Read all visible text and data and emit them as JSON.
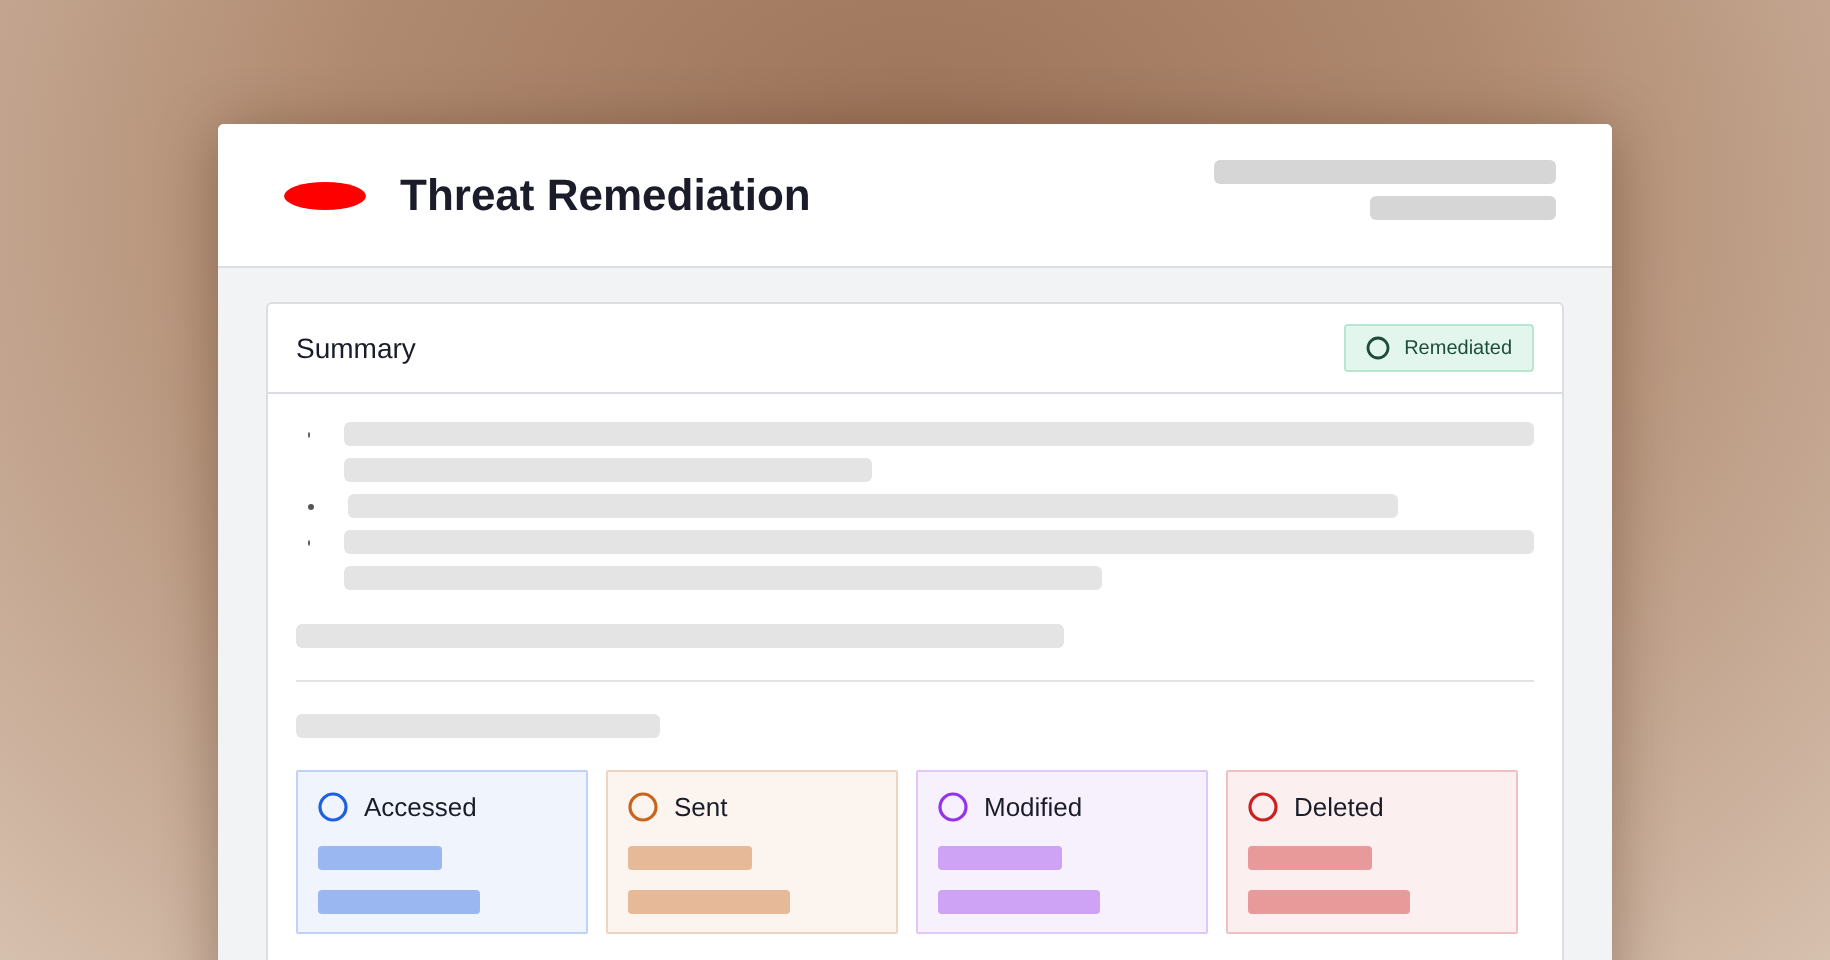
{
  "window": {
    "title": "Threat Remediation"
  },
  "summary": {
    "title": "Summary",
    "status": "Remediated"
  },
  "categories": [
    {
      "label": "Accessed",
      "color": "#1f5fe0"
    },
    {
      "label": "Sent",
      "color": "#c8651a"
    },
    {
      "label": "Modified",
      "color": "#9333ea"
    },
    {
      "label": "Deleted",
      "color": "#cc1f1f"
    }
  ]
}
